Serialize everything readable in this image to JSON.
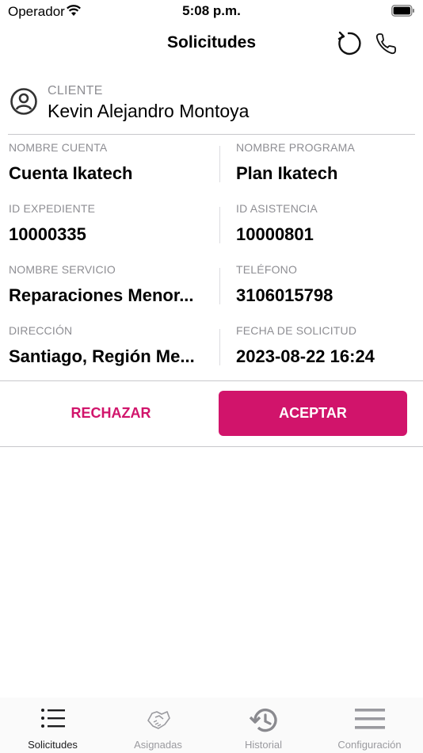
{
  "status_bar": {
    "carrier": "Operador",
    "time": "5:08 p.m."
  },
  "nav": {
    "title": "Solicitudes",
    "refresh_icon": "refresh-icon",
    "phone_icon": "phone-icon"
  },
  "client": {
    "label": "CLIENTE",
    "name": "Kevin Alejandro Montoya"
  },
  "details": [
    {
      "label": "NOMBRE CUENTA",
      "value": "Cuenta Ikatech"
    },
    {
      "label": "NOMBRE PROGRAMA",
      "value": "Plan Ikatech"
    },
    {
      "label": "ID EXPEDIENTE",
      "value": "10000335"
    },
    {
      "label": "ID ASISTENCIA",
      "value": "10000801"
    },
    {
      "label": "NOMBRE SERVICIO",
      "value": "Reparaciones Menor..."
    },
    {
      "label": "TELÉFONO",
      "value": "3106015798"
    },
    {
      "label": "DIRECCIÓN",
      "value": "Santiago, Región Me..."
    },
    {
      "label": "FECHA DE SOLICITUD",
      "value": "2023-08-22 16:24"
    }
  ],
  "actions": {
    "reject_label": "RECHAZAR",
    "accept_label": "ACEPTAR"
  },
  "tabs": [
    {
      "label": "Solicitudes",
      "icon": "list-icon",
      "active": true
    },
    {
      "label": "Asignadas",
      "icon": "handshake-icon",
      "active": false
    },
    {
      "label": "Historial",
      "icon": "history-icon",
      "active": false
    },
    {
      "label": "Configuración",
      "icon": "menu-icon",
      "active": false
    }
  ],
  "colors": {
    "accent": "#d1146b",
    "muted": "#8e8e93"
  }
}
